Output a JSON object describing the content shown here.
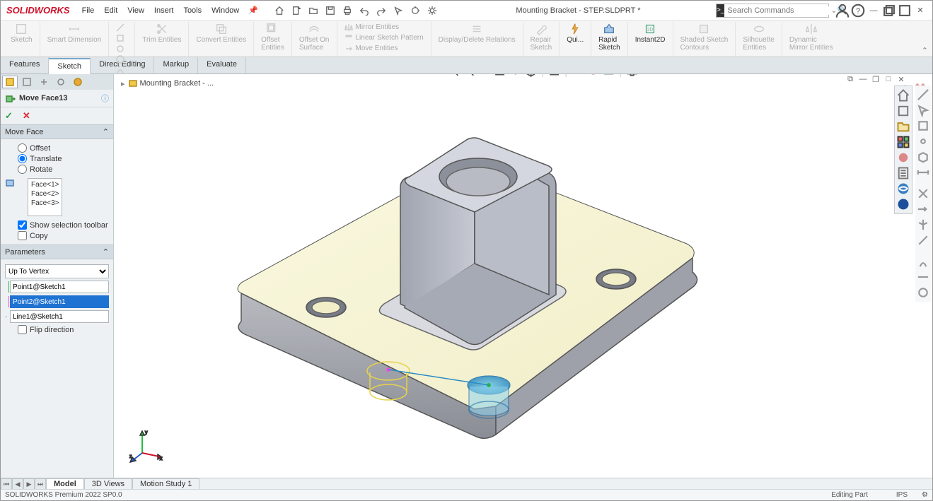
{
  "app": {
    "brand": "SOLIDWORKS",
    "doc_title": "Mounting Bracket - STEP.SLDPRT *",
    "breadcrumb": "Mounting Bracket - ..."
  },
  "menu": {
    "items": [
      "File",
      "Edit",
      "View",
      "Insert",
      "Tools",
      "Window"
    ]
  },
  "search": {
    "placeholder": "Search Commands"
  },
  "ribbon": {
    "sketch": "Sketch",
    "smart_dimension": "Smart Dimension",
    "trim": "Trim Entities",
    "convert": "Convert Entities",
    "offset_entities": "Offset\nEntities",
    "offset_surface": "Offset On\nSurface",
    "mirror": "Mirror Entities",
    "linear_pattern": "Linear Sketch Pattern",
    "move": "Move Entities",
    "display_relations": "Display/Delete Relations",
    "repair": "Repair\nSketch",
    "quick_snaps": "Qui...",
    "rapid_sketch": "Rapid\nSketch",
    "instant2d": "Instant2D",
    "shaded_contours": "Shaded Sketch\nContours",
    "silhouette": "Silhouette\nEntities",
    "dynamic_mirror": "Dynamic\nMirror Entities"
  },
  "tabs": {
    "items": [
      "Features",
      "Sketch",
      "Direct Editing",
      "Markup",
      "Evaluate"
    ],
    "active": 1
  },
  "pm": {
    "title": "Move Face13",
    "section_move": "Move Face",
    "opt_offset": "Offset",
    "opt_translate": "Translate",
    "opt_rotate": "Rotate",
    "faces": [
      "Face<1>",
      "Face<2>",
      "Face<3>"
    ],
    "show_toolbar": "Show selection toolbar",
    "copy": "Copy",
    "section_params": "Parameters",
    "end_condition": "Up To Vertex",
    "point1": "Point1@Sketch1",
    "point2": "Point2@Sketch1",
    "line": "Line1@Sketch1",
    "flip": "Flip direction"
  },
  "bottom_tabs": {
    "items": [
      "Model",
      "3D Views",
      "Motion Study 1"
    ],
    "active": 0
  },
  "status": {
    "left": "SOLIDWORKS Premium 2022 SP0.0",
    "mode": "Editing Part",
    "units": "IPS"
  }
}
